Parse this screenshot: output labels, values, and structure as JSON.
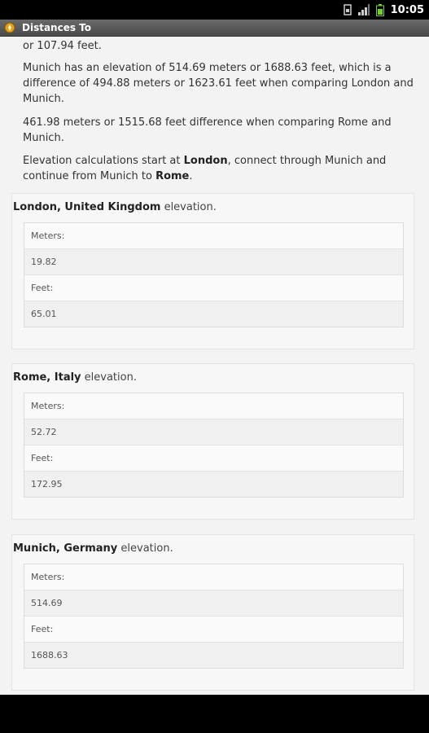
{
  "status": {
    "time": "10:05"
  },
  "app": {
    "title": "Distances To"
  },
  "intro": {
    "p0": "or 107.94 feet.",
    "p1": "Munich has an elevation of 514.69 meters or 1688.63 feet, which is a difference of 494.88 meters or 1623.61 feet when comparing London and Munich.",
    "p2": "461.98 meters or 1515.68 feet difference when comparing Rome and Munich.",
    "p3_prefix": "Elevation calculations start at ",
    "p3_bold1": "London",
    "p3_mid": ", connect through Munich and continue from Munich to ",
    "p3_bold2": "Rome",
    "p3_suffix": "."
  },
  "panels": [
    {
      "place": "London, United Kingdom",
      "suffix": " elevation.",
      "meters_label": "Meters:",
      "meters": "19.82",
      "feet_label": "Feet:",
      "feet": "65.01"
    },
    {
      "place": "Rome, Italy",
      "suffix": " elevation.",
      "meters_label": "Meters:",
      "meters": "52.72",
      "feet_label": "Feet:",
      "feet": "172.95"
    },
    {
      "place": "Munich, Germany",
      "suffix": " elevation.",
      "meters_label": "Meters:",
      "meters": "514.69",
      "feet_label": "Feet:",
      "feet": "1688.63"
    }
  ],
  "icons": {
    "app": "compass-icon",
    "signal": "signal-icon",
    "battery": "battery-icon",
    "sim": "sim-icon"
  }
}
